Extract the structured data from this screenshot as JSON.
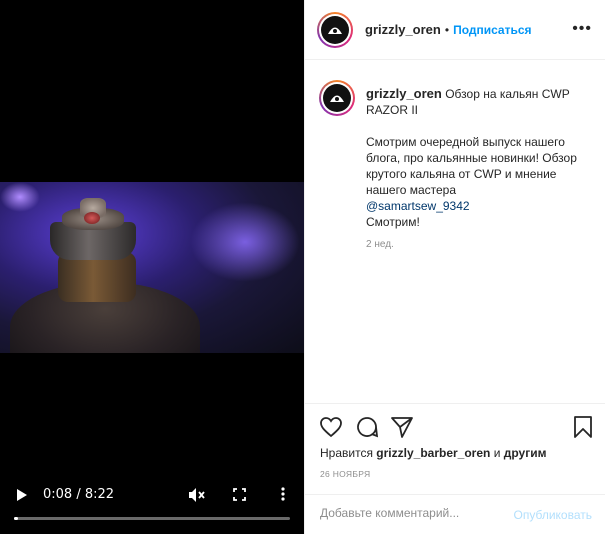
{
  "video": {
    "current_time": "0:08",
    "duration": "8:22",
    "time_display": "0:08 / 8:22",
    "progress": 0.016,
    "icons": [
      "play-icon",
      "mute-icon",
      "fullscreen-icon",
      "more-vert-icon"
    ]
  },
  "header": {
    "username": "grizzly_oren",
    "separator": "•",
    "follow_label": "Подписаться",
    "more_label": "•••"
  },
  "caption": {
    "username": "grizzly_oren",
    "title": "Обзор на кальян CWP RAZOR II",
    "body": "Смотрим очередной выпуск нашего блога, про кальянные новинки! Обзор крутого кальяна от CWP и мнение нашего мастера",
    "mention": "@samartsew_9342",
    "tail": "Смотрим!",
    "age": "2 нед."
  },
  "actions": {
    "likes_prefix": "Нравится",
    "likes_user": "grizzly_barber_oren",
    "likes_middle": "и",
    "likes_others": "другим",
    "date": "26 НОЯБРЯ"
  },
  "comment": {
    "placeholder": "Добавьте комментарий...",
    "publish_label": "Опубликовать"
  },
  "colors": {
    "accent": "#0095f6",
    "publish_disabled": "#b2dffc",
    "text": "#262626",
    "muted": "#8e8e8e"
  }
}
